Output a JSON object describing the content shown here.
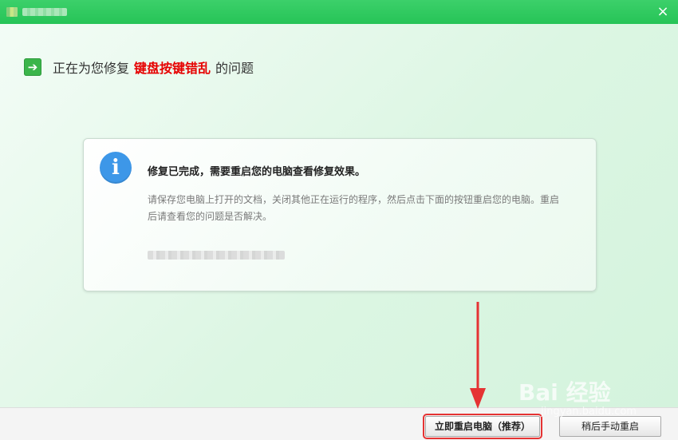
{
  "window": {
    "close_label": "×"
  },
  "heading": {
    "prefix": "正在为您修复",
    "highlight": "键盘按键错乱",
    "suffix": "的问题"
  },
  "card": {
    "icon_glyph": "i",
    "title": "修复已完成，需要重启您的电脑查看修复效果。",
    "description": "请保存您电脑上打开的文档，关闭其他正在运行的程序，然后点击下面的按钮重启您的电脑。重启后请查看您的问题是否解决。"
  },
  "footer": {
    "restart_now_label": "立即重启电脑（推荐）",
    "restart_later_label": "稍后手动重启"
  },
  "watermark": {
    "main": "Bai 经验",
    "sub": "jingyan.baidu.com"
  },
  "colors": {
    "titlebar": "#26c457",
    "highlight": "#e60000",
    "info_icon": "#3d97e8",
    "annotation": "#e53333"
  }
}
